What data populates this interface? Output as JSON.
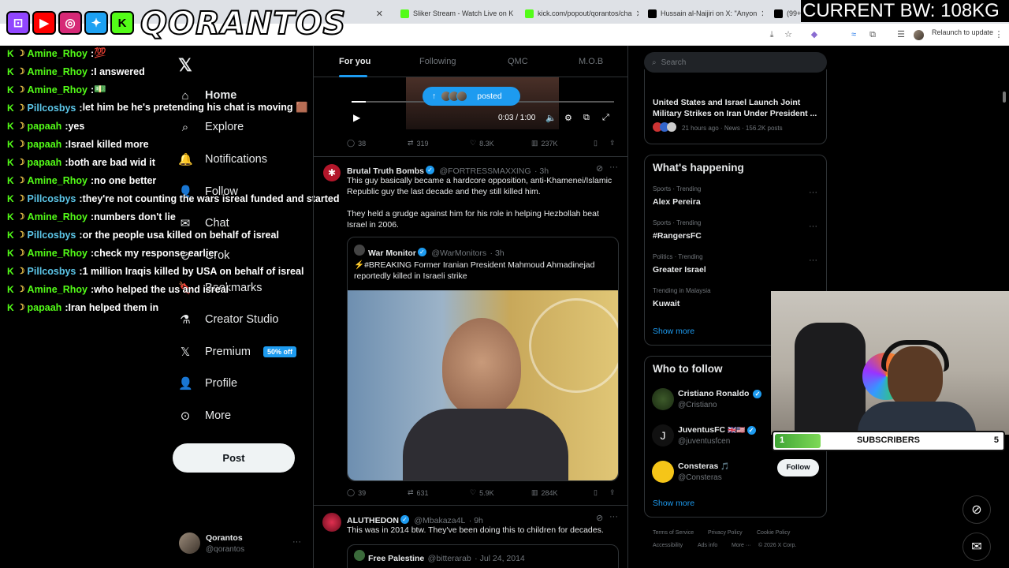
{
  "browser": {
    "tabs": [
      {
        "title": "tch",
        "favicon_color": "#dee1e6"
      },
      {
        "title": "Sliker Stream - Watch Live on K",
        "favicon_color": "#53fc18"
      },
      {
        "title": "kick.com/popout/qorantos/cha",
        "favicon_color": "#53fc18"
      },
      {
        "title": "Hussain al-Naijiri on X: \"Anyon",
        "favicon_color": "#000000"
      },
      {
        "title": "(99+",
        "favicon_color": "#000000"
      }
    ],
    "relaunch_label": "Relaunch to update"
  },
  "overlay": {
    "brand_name": "QORANTOS",
    "bw_label": "CURRENT BW: 108KG",
    "subscribers_label": "SUBSCRIBERS",
    "subscribers_current": "1",
    "subscribers_goal": "5",
    "subscribers_progress": 0.2
  },
  "chat": [
    {
      "user": "Amine_Rhoy",
      "color": "#53fc18",
      "msg": "💯"
    },
    {
      "user": "Amine_Rhoy",
      "color": "#53fc18",
      "msg": "I answered"
    },
    {
      "user": "Amine_Rhoy",
      "color": "#53fc18",
      "msg": "💵"
    },
    {
      "user": "Pillcosbys",
      "color": "#5cc6e8",
      "msg": "let him be he's pretending his chat is moving 🟫"
    },
    {
      "user": "papaah",
      "color": "#53fc18",
      "msg": "yes"
    },
    {
      "user": "papaah",
      "color": "#53fc18",
      "msg": "Israel killed more"
    },
    {
      "user": "papaah",
      "color": "#53fc18",
      "msg": "both are bad wid it"
    },
    {
      "user": "Amine_Rhoy",
      "color": "#53fc18",
      "msg": "no one better"
    },
    {
      "user": "Pillcosbys",
      "color": "#5cc6e8",
      "msg": "they're not counting the wars isreal funded and started"
    },
    {
      "user": "Amine_Rhoy",
      "color": "#53fc18",
      "msg": "numbers don't lie"
    },
    {
      "user": "Pillcosbys",
      "color": "#5cc6e8",
      "msg": "or the people usa killed on behalf of isreal"
    },
    {
      "user": "Amine_Rhoy",
      "color": "#53fc18",
      "msg": "check my response earlier"
    },
    {
      "user": "Pillcosbys",
      "color": "#5cc6e8",
      "msg": "1 million Iraqis killed by USA on behalf of isreal"
    },
    {
      "user": "Amine_Rhoy",
      "color": "#53fc18",
      "msg": "who helped the us and isreal"
    },
    {
      "user": "papaah",
      "color": "#53fc18",
      "msg": "Iran helped them in"
    }
  ],
  "nav": {
    "items": [
      {
        "label": "Home",
        "icon": "home-icon"
      },
      {
        "label": "Explore",
        "icon": "search-icon"
      },
      {
        "label": "Notifications",
        "icon": "bell-icon"
      },
      {
        "label": "Follow",
        "icon": "person-add-icon"
      },
      {
        "label": "Chat",
        "icon": "mail-icon"
      },
      {
        "label": "Grok",
        "icon": "grok-icon"
      },
      {
        "label": "Bookmarks",
        "icon": "bookmark-icon"
      },
      {
        "label": "Creator Studio",
        "icon": "flask-icon"
      },
      {
        "label": "Premium",
        "icon": "x-logo-icon"
      },
      {
        "label": "Profile",
        "icon": "person-icon"
      },
      {
        "label": "More",
        "icon": "more-circle-icon"
      }
    ],
    "premium_badge": "50% off",
    "post_label": "Post",
    "account_name": "Qorantos",
    "account_handle": "@qorantos"
  },
  "feed": {
    "tabs": [
      "For you",
      "Following",
      "QMC",
      "M.O.B"
    ],
    "video": {
      "posted_label": "posted",
      "time": "0:03 / 1:00"
    },
    "first_stats": {
      "replies": "38",
      "reposts": "319",
      "likes": "8.3K",
      "views": "237K"
    },
    "tweet1": {
      "name": "Brutal Truth Bombs",
      "handle": "@FORTRESSMAXXING",
      "time": "3h",
      "text1": "This guy basically became a hardcore opposition, anti-Khamenei/Islamic Republic guy the last decade and they still killed him.",
      "text2": "They held a grudge against him for his role in helping Hezbollah beat Israel in 2006.",
      "quote_name": "War Monitor",
      "quote_handle": "@WarMonitors",
      "quote_time": "3h",
      "quote_text": "⚡#BREAKING Former Iranian President Mahmoud Ahmadinejad reportedly killed in Israeli strike",
      "stats": {
        "replies": "39",
        "reposts": "631",
        "likes": "5.9K",
        "views": "284K"
      }
    },
    "tweet2": {
      "name": "ALUTHEDON",
      "handle": "@Mbakaza4L",
      "time": "9h",
      "text": "This was in 2014 btw. They've been doing this to children for decades.",
      "quote_name": "Free Palestine",
      "quote_handle": "@bitterarab",
      "quote_time": "Jul 24, 2014"
    }
  },
  "sidebar": {
    "search_placeholder": "Search",
    "news_title": "United States and Israel Launch Joint Military Strikes on Iran Under President ...",
    "news_meta": "21 hours ago · News · 156.2K posts",
    "happening_title": "What's happening",
    "trends": [
      {
        "meta": "Sports · Trending",
        "name": "Alex Pereira"
      },
      {
        "meta": "Sports · Trending",
        "name": "#RangersFC"
      },
      {
        "meta": "Politics · Trending",
        "name": "Greater Israel"
      },
      {
        "meta": "Trending in Malaysia",
        "name": "Kuwait"
      }
    ],
    "show_more": "Show more",
    "follow_title": "Who to follow",
    "follow": [
      {
        "name": "Cristiano Ronaldo",
        "handle": "@Cristiano",
        "flags": ""
      },
      {
        "name": "JuventusFC",
        "handle": "@juventusfcen",
        "flags": "🇬🇧🇺🇸"
      },
      {
        "name": "Consteras",
        "handle": "@Consteras",
        "flags": "🎵"
      }
    ],
    "follow_btn": "Follow",
    "footer": [
      "Terms of Service",
      "Privacy Policy",
      "Cookie Policy",
      "Accessibility",
      "Ads info",
      "More ···",
      "© 2026 X Corp."
    ]
  }
}
